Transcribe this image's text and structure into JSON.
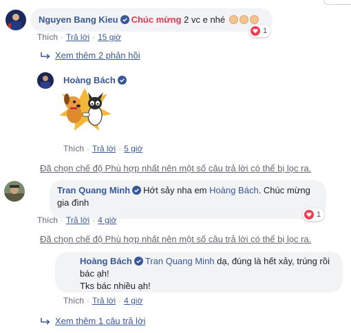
{
  "colors": {
    "link": "#385898",
    "bubble": "#f2f3f5",
    "heart": "#f33e58",
    "celebrate": "#e2374f",
    "meta": "#616770"
  },
  "comments": [
    {
      "author": "Nguyen Bang Kieu",
      "highlight": "Chúc mừng",
      "text": " 2 vc e nhé",
      "reaction_count": "1",
      "like": "Thích",
      "reply": "Trả lời",
      "time": "15 giờ"
    },
    {
      "author": "Hoàng Bách",
      "sticker": "dog-and-cat-sticker",
      "like": "Thích",
      "reply": "Trả lời",
      "time": "5 giờ"
    },
    {
      "author": "Tran Quang Minh",
      "text_before": "Hớt sảy nha em ",
      "mention": "Hoàng Bách",
      "text_after": ". Chúc mừng gia đình",
      "reaction_count": "1",
      "like": "Thích",
      "reply": "Trả lời",
      "time": "4 giờ"
    },
    {
      "author": "Hoàng Bách",
      "mention": "Tran Quang Minh",
      "text_line1": " dạ, đúng là hết xảy, trúng rồi",
      "text_line2": "bác ạh!",
      "text_line3": "Tks bác nhiều ạh!",
      "like": "Thích",
      "reply": "Trả lời",
      "time": "4 giờ"
    }
  ],
  "more_replies_1": "Xem thêm 2 phản hồi",
  "more_replies_2": "Xem thêm 1 câu trả lời",
  "filter_notice": "Đã chọn chế độ Phù hợp nhất nên một số câu trả lời có thể bị lọc ra.",
  "separator": "·"
}
